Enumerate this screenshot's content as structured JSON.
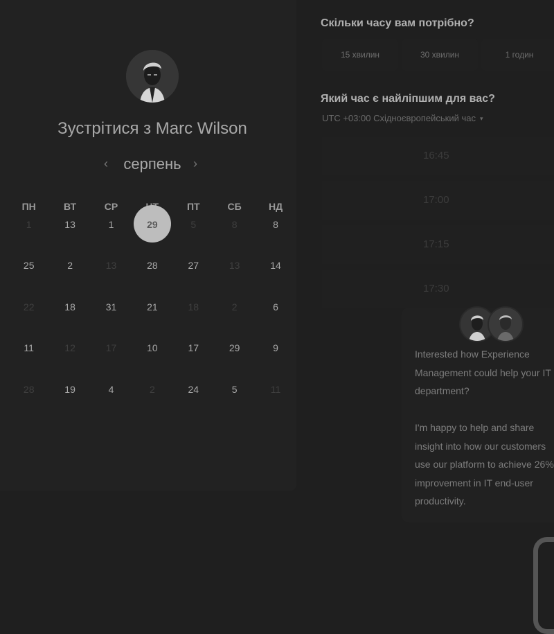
{
  "scheduler": {
    "title": "Зустрітися з Marc Wilson",
    "month": "серпень",
    "prev_icon": "‹",
    "next_icon": "›",
    "weekdays": [
      "ПН",
      "ВТ",
      "СР",
      "ЧТ",
      "ПТ",
      "СБ",
      "НД"
    ],
    "weeks": [
      [
        "1",
        "13",
        "1",
        "29",
        "5",
        "8",
        "8"
      ],
      [
        "25",
        "2",
        "13",
        "28",
        "27",
        "13",
        "14"
      ],
      [
        "22",
        "18",
        "31",
        "21",
        "18",
        "2",
        "6"
      ],
      [
        "11",
        "12",
        "17",
        "10",
        "17",
        "29",
        "9"
      ],
      [
        "28",
        "19",
        "4",
        "2",
        "24",
        "5",
        "11"
      ]
    ],
    "dimmed": [
      [
        true,
        false,
        false,
        false,
        true,
        true,
        false
      ],
      [
        false,
        false,
        true,
        false,
        false,
        true,
        false
      ],
      [
        true,
        false,
        false,
        false,
        true,
        true,
        false
      ],
      [
        false,
        true,
        true,
        false,
        false,
        false,
        false
      ],
      [
        true,
        false,
        false,
        true,
        false,
        false,
        true
      ]
    ],
    "selected_day": "29"
  },
  "duration": {
    "question": "Скільки часу вам потрібно?",
    "options": [
      "15 хвилин",
      "30 хвилин",
      "1 годин"
    ]
  },
  "time": {
    "question": "Який час є найліпшим для вас?",
    "timezone": "UTC +03:00 Східноєвропейський час",
    "caret": "▾",
    "slots": [
      "16:45",
      "17:00",
      "17:15",
      "17:30"
    ]
  },
  "chat": {
    "lines_1": [
      "Interested how Experience",
      "Management could help your IT",
      "department?"
    ],
    "lines_2": [
      "I'm happy to help and share",
      "insight into how our customers",
      "use our platform to achieve 26%",
      "improvement in IT end-user",
      "productivity."
    ]
  }
}
